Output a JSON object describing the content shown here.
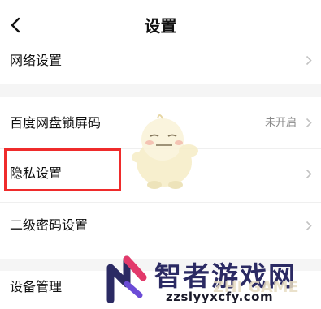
{
  "header": {
    "title": "设置",
    "back_icon": "chevron-left-icon"
  },
  "settings": {
    "network": {
      "label": "网络设置"
    },
    "lock_screen": {
      "label": "百度网盘锁屏码",
      "value": "未开启"
    },
    "privacy": {
      "label": "隐私设置"
    },
    "secondary_password": {
      "label": "二级密码设置"
    },
    "device_management": {
      "label": "设备管理"
    }
  },
  "annotation": {
    "highlight_color": "#ef2b2b"
  },
  "watermark": {
    "brand_cn": "智者游戏网",
    "url": "zzslyyxcfy.com",
    "sub_text": "ZHI GAME",
    "brand_color": "#2b2a63"
  },
  "colors": {
    "background": "#f5f5f5",
    "card": "#ffffff",
    "secondary_text": "#8a8a8a"
  }
}
